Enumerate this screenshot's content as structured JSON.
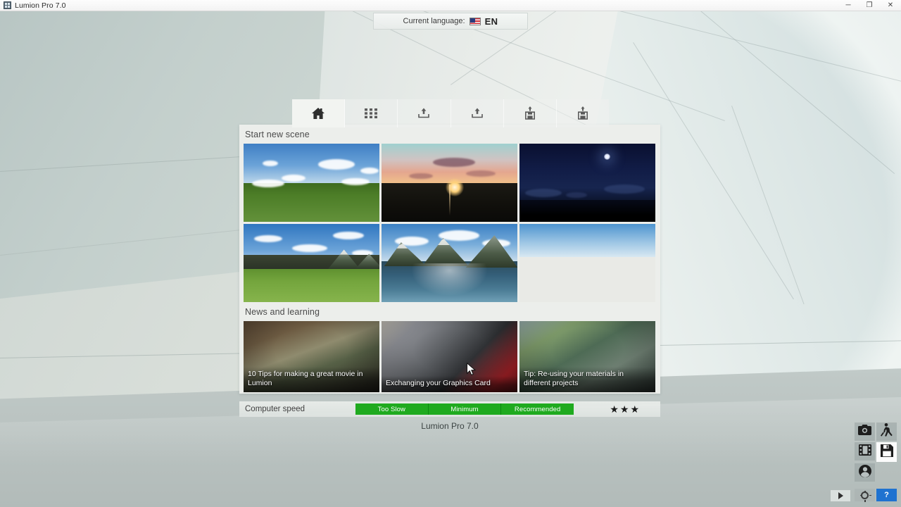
{
  "window": {
    "title": "Lumion Pro 7.0",
    "app_icon": "lumion-icon",
    "controls": [
      {
        "name": "minimize",
        "glyph": "─"
      },
      {
        "name": "restore",
        "glyph": "❐"
      },
      {
        "name": "close",
        "glyph": "✕"
      }
    ]
  },
  "language_bar": {
    "label": "Current language:",
    "flag": "us-flag-icon",
    "code": "EN"
  },
  "tabs": [
    {
      "name": "tab-home",
      "icon": "home-icon",
      "active": true
    },
    {
      "name": "tab-examples",
      "icon": "grid-icon",
      "active": false
    },
    {
      "name": "tab-load-scene",
      "icon": "load-tray-icon",
      "active": false
    },
    {
      "name": "tab-import",
      "icon": "load-tray-icon-2",
      "active": false
    },
    {
      "name": "tab-save-scene",
      "icon": "save-disk-icon",
      "active": false
    },
    {
      "name": "tab-save-as",
      "icon": "save-disk-icon-2",
      "active": false
    }
  ],
  "scenes_section": {
    "title": "Start new scene",
    "items": [
      {
        "name": "scene-plain",
        "style": "s-day",
        "selected": true
      },
      {
        "name": "scene-sunset",
        "style": "s-sun",
        "selected": false
      },
      {
        "name": "scene-night",
        "style": "s-night",
        "selected": false
      },
      {
        "name": "scene-mountain",
        "style": "s-mtn",
        "selected": false
      },
      {
        "name": "scene-lake",
        "style": "s-lake",
        "selected": false
      },
      {
        "name": "scene-white",
        "style": "s-white",
        "selected": false
      }
    ]
  },
  "news_section": {
    "title": "News and learning",
    "items": [
      {
        "name": "news-movie-tips",
        "caption": "10 Tips for making a great movie in Lumion",
        "style": "n1"
      },
      {
        "name": "news-graphics-card",
        "caption": "Exchanging your Graphics Card",
        "style": "n2"
      },
      {
        "name": "news-materials-tip",
        "caption": "Tip: Re-using your materials in different projects",
        "style": "n3"
      }
    ]
  },
  "computer_speed": {
    "label": "Computer speed",
    "segments": [
      {
        "label": "Too Slow",
        "color": "#1faa1f"
      },
      {
        "label": "Minimum",
        "color": "#1faa1f"
      },
      {
        "label": "Recommended",
        "color": "#1faa1f"
      }
    ],
    "rating": "★★★",
    "rating_value": 3
  },
  "footer": {
    "version": "Lumion Pro 7.0"
  },
  "toolbar": {
    "buttons": [
      {
        "name": "photo-mode-button",
        "icon": "camera-icon"
      },
      {
        "name": "walk-mode-button",
        "icon": "person-walking-icon"
      },
      {
        "name": "movie-mode-button",
        "icon": "film-strip-icon"
      },
      {
        "name": "save-scene-button",
        "icon": "floppy-disk-icon"
      },
      {
        "name": "person-mode-button",
        "icon": "person-head-icon"
      }
    ],
    "settings_button": {
      "name": "settings-button",
      "icon": "gear-icon"
    },
    "help_button": {
      "name": "help-button",
      "label": "?",
      "color": "#1f72d0"
    },
    "play_button": {
      "name": "play-button",
      "icon": "play-triangle-icon"
    }
  },
  "colors": {
    "accent_green": "#1faa1f",
    "help_blue": "#1f72d0",
    "panel_bg": "#eceeeb"
  }
}
